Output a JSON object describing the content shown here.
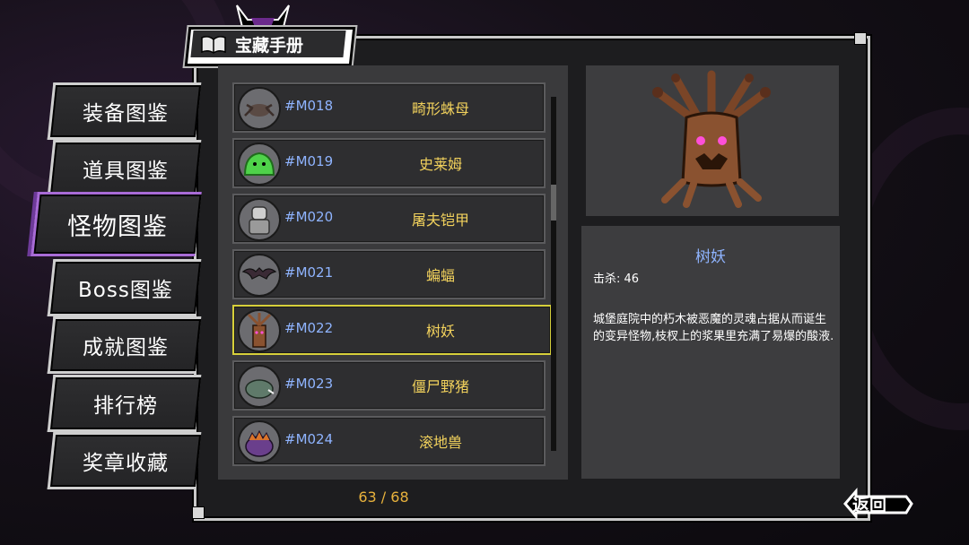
{
  "title": "宝藏手册",
  "nav": [
    {
      "label": "装备图鉴",
      "active": false
    },
    {
      "label": "道具图鉴",
      "active": false
    },
    {
      "label": "怪物图鉴",
      "active": true
    },
    {
      "label": "Boss图鉴",
      "active": false
    },
    {
      "label": "成就图鉴",
      "active": false
    },
    {
      "label": "排行榜",
      "active": false
    },
    {
      "label": "奖章收藏",
      "active": false
    }
  ],
  "monsters": [
    {
      "id": "#M018",
      "name": "畸形蛛母",
      "icon": "spider-mother-icon"
    },
    {
      "id": "#M019",
      "name": "史莱姆",
      "icon": "slime-icon"
    },
    {
      "id": "#M020",
      "name": "屠夫铠甲",
      "icon": "butcher-armor-icon"
    },
    {
      "id": "#M021",
      "name": "蝙蝠",
      "icon": "bat-icon"
    },
    {
      "id": "#M022",
      "name": "树妖",
      "icon": "treant-icon",
      "selected": true
    },
    {
      "id": "#M023",
      "name": "僵尸野猪",
      "icon": "zombie-boar-icon"
    },
    {
      "id": "#M024",
      "name": "滚地兽",
      "icon": "roller-beast-icon"
    }
  ],
  "page_count": "63 / 68",
  "detail": {
    "name": "树妖",
    "kills": "击杀: 46",
    "description": "城堡庭院中的朽木被恶魔的灵魂占据从而诞生的变异怪物,枝杈上的浆果里充满了易爆的酸液."
  },
  "back_label": "返回",
  "colors": {
    "accent_purple": "#a86bd6",
    "selected_border": "#d6cf3a",
    "id_blue": "#8fb4ff",
    "name_gold": "#f1d15c"
  }
}
